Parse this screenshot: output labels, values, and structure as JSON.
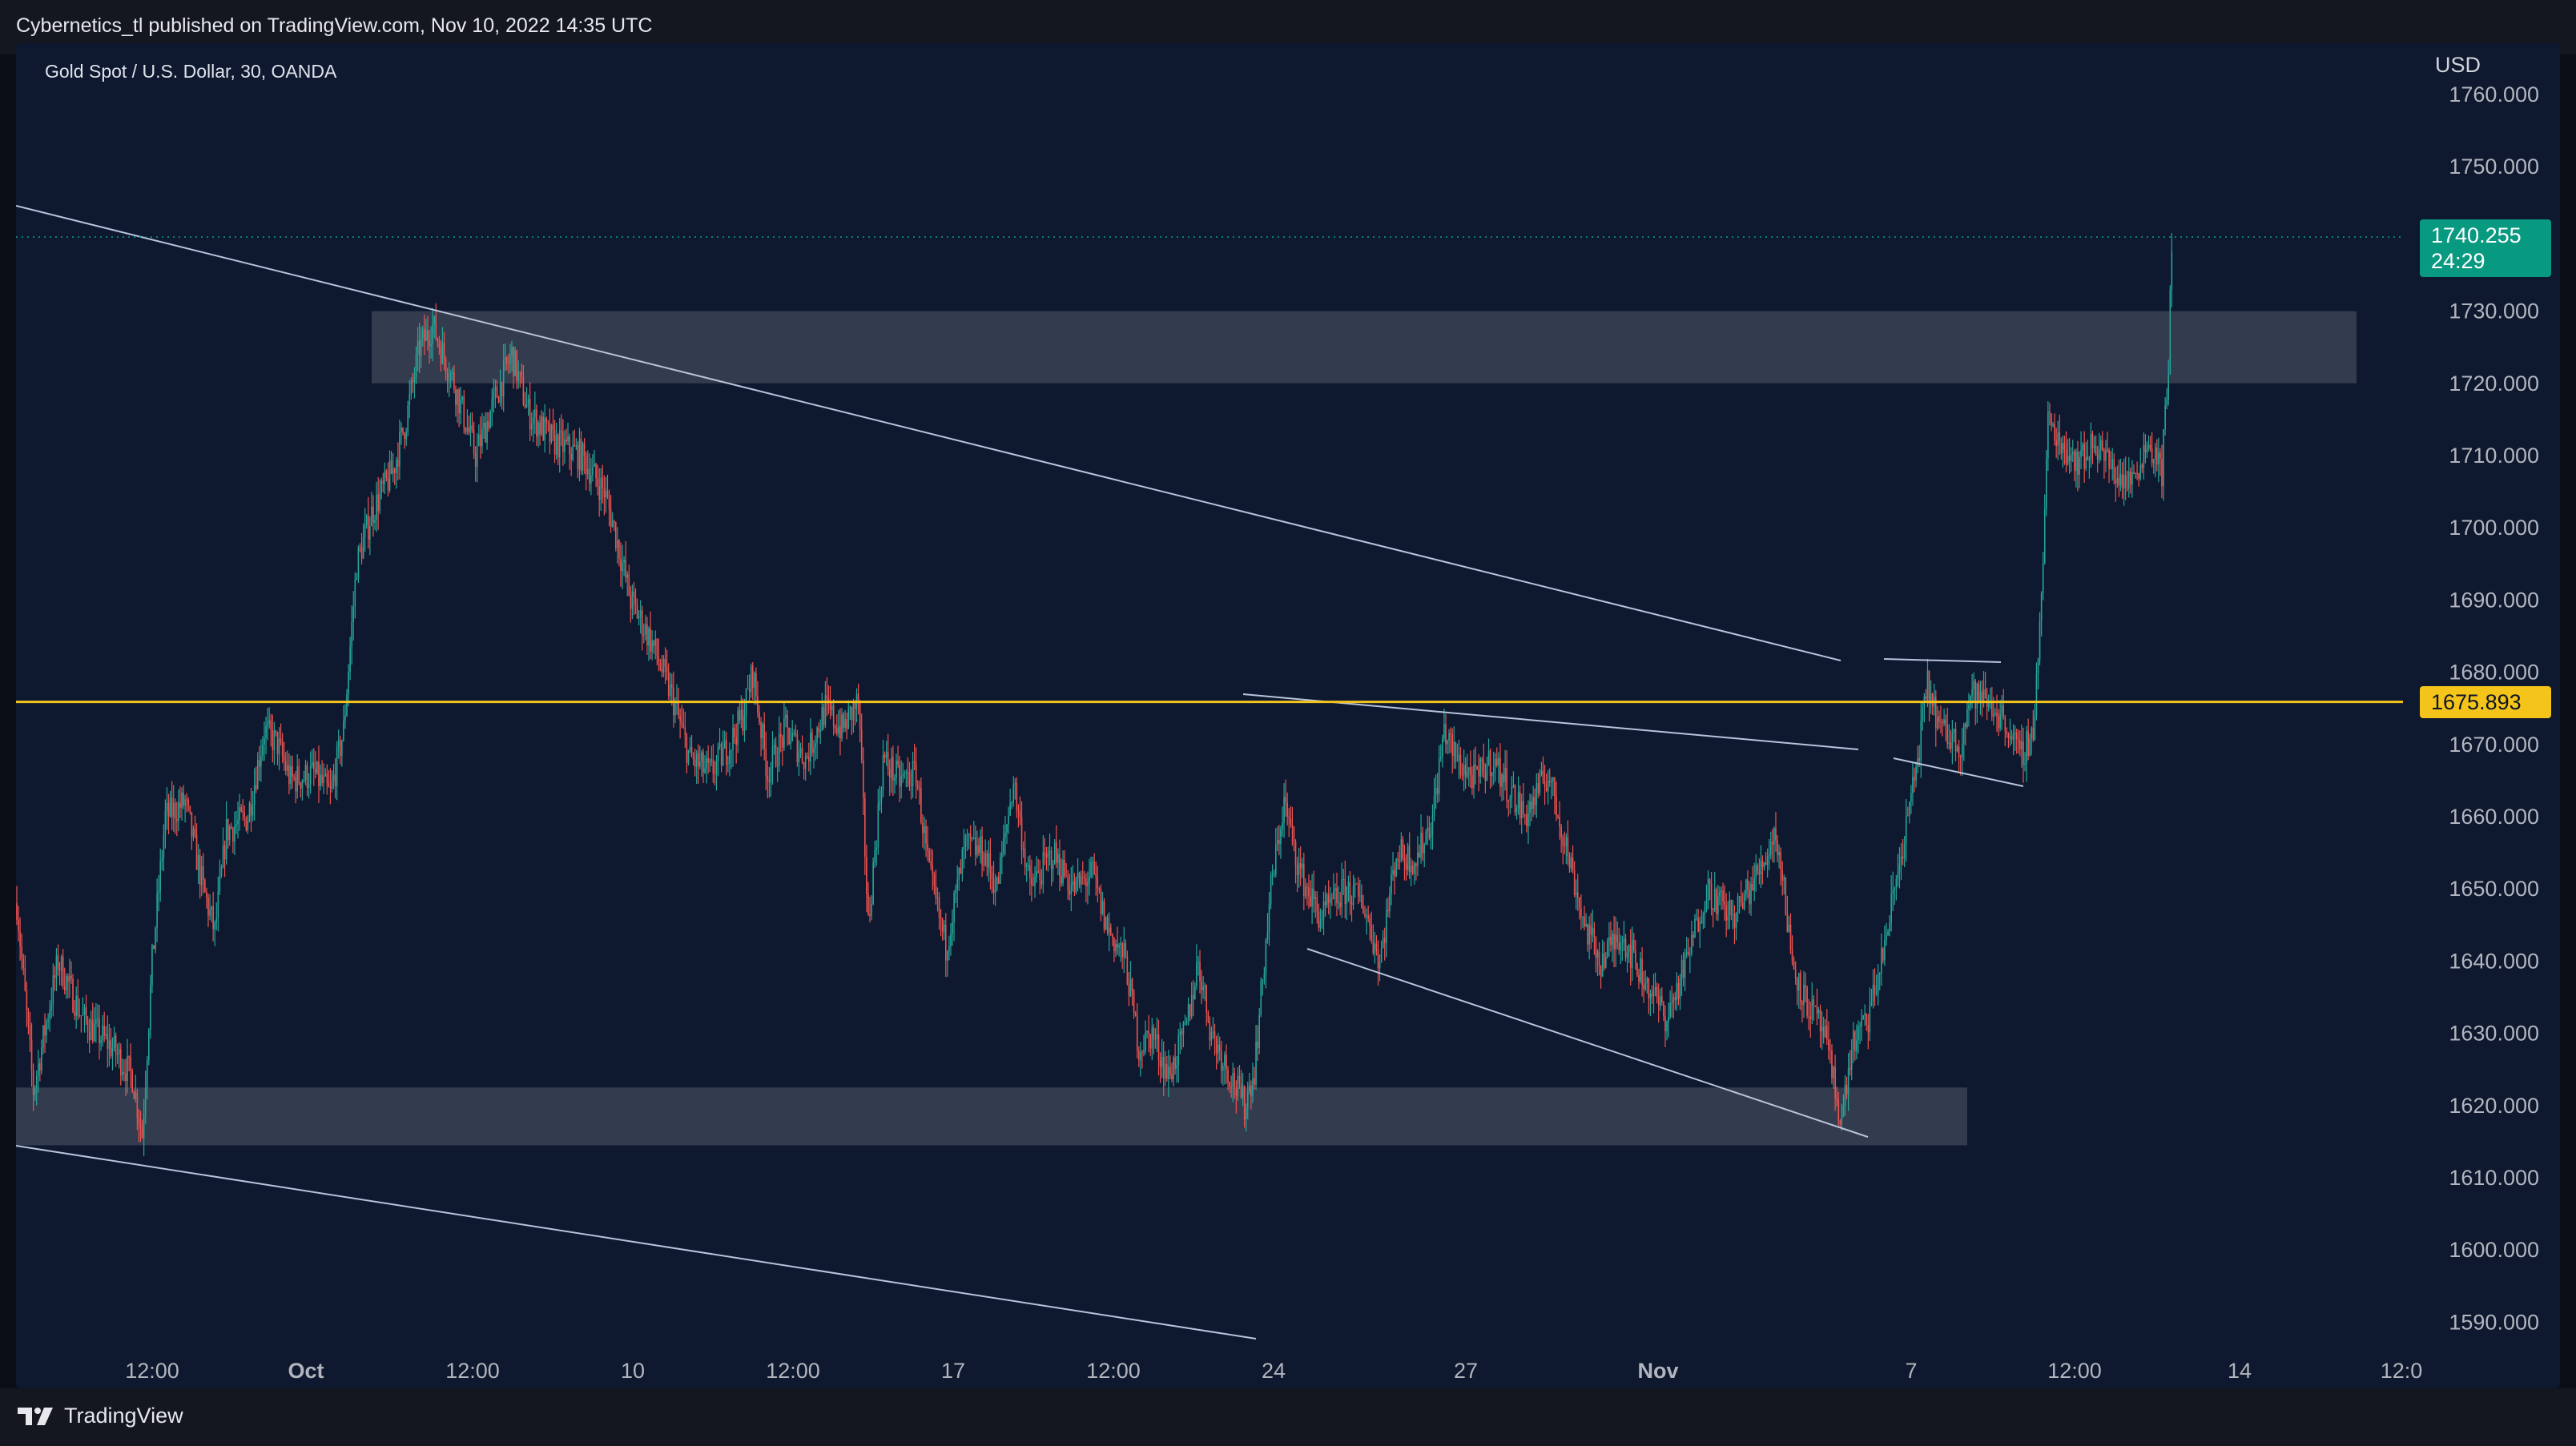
{
  "header": {
    "published_by": "Cybernetics_tl published on TradingView.com, Nov 10, 2022 14:35 UTC"
  },
  "footer": {
    "logo_text": "TradingView"
  },
  "chart_data": {
    "type": "candlestick",
    "symbol_label": "Gold Spot / U.S. Dollar, 30, OANDA",
    "currency": "USD",
    "timeframe_minutes": 30,
    "ylim": [
      1586,
      1762
    ],
    "y_ticks": [
      1590,
      1600,
      1610,
      1620,
      1630,
      1640,
      1650,
      1660,
      1670,
      1680,
      1690,
      1700,
      1710,
      1720,
      1730,
      1740,
      1750,
      1760
    ],
    "x_ticks": [
      "12:00",
      "Oct",
      "12:00",
      "10",
      "12:00",
      "17",
      "12:00",
      "24",
      "27",
      "Nov",
      "7",
      "12:00",
      "14",
      "12:0"
    ],
    "last_price": {
      "value": "1740.255",
      "countdown": "24:29",
      "numeric": 1740.255
    },
    "horizontal_level": {
      "value": "1675.893",
      "numeric": 1675.893,
      "color": "#f5c41a"
    },
    "supply_zone": {
      "from": 1720,
      "to": 1730
    },
    "demand_zone": {
      "from": 1614.5,
      "to": 1622.5
    },
    "colors": {
      "background": "#0e182e",
      "bull": "#26a69a",
      "bear": "#ef5350",
      "zone": "#3a4254",
      "trendline": "#b8c4dc",
      "last_price": "#089981",
      "level": "#f5c41a"
    },
    "price_path": [
      [
        0,
        1648
      ],
      [
        10,
        1622
      ],
      [
        25,
        1640
      ],
      [
        40,
        1632
      ],
      [
        58,
        1628
      ],
      [
        70,
        1624
      ],
      [
        76,
        1616
      ],
      [
        82,
        1640
      ],
      [
        90,
        1660
      ],
      [
        102,
        1662
      ],
      [
        113,
        1650
      ],
      [
        120,
        1644
      ],
      [
        127,
        1658
      ],
      [
        140,
        1660
      ],
      [
        150,
        1672
      ],
      [
        158,
        1670
      ],
      [
        166,
        1665
      ],
      [
        180,
        1666
      ],
      [
        190,
        1663
      ],
      [
        198,
        1672
      ],
      [
        206,
        1695
      ],
      [
        215,
        1702
      ],
      [
        228,
        1708
      ],
      [
        236,
        1715
      ],
      [
        244,
        1725
      ],
      [
        252,
        1728
      ],
      [
        265,
        1720
      ],
      [
        278,
        1710
      ],
      [
        290,
        1718
      ],
      [
        300,
        1724
      ],
      [
        310,
        1716
      ],
      [
        325,
        1712
      ],
      [
        342,
        1710
      ],
      [
        356,
        1705
      ],
      [
        362,
        1700
      ],
      [
        372,
        1690
      ],
      [
        385,
        1684
      ],
      [
        398,
        1676
      ],
      [
        408,
        1668
      ],
      [
        420,
        1666
      ],
      [
        432,
        1670
      ],
      [
        440,
        1674
      ],
      [
        446,
        1680
      ],
      [
        455,
        1666
      ],
      [
        466,
        1672
      ],
      [
        478,
        1668
      ],
      [
        490,
        1675
      ],
      [
        500,
        1672
      ],
      [
        510,
        1676
      ],
      [
        516,
        1645
      ],
      [
        525,
        1668
      ],
      [
        535,
        1665
      ],
      [
        545,
        1666
      ],
      [
        553,
        1652
      ],
      [
        563,
        1642
      ],
      [
        575,
        1656
      ],
      [
        586,
        1655
      ],
      [
        594,
        1650
      ],
      [
        604,
        1665
      ],
      [
        614,
        1650
      ],
      [
        628,
        1655
      ],
      [
        640,
        1650
      ],
      [
        652,
        1652
      ],
      [
        660,
        1645
      ],
      [
        672,
        1640
      ],
      [
        680,
        1628
      ],
      [
        688,
        1630
      ],
      [
        698,
        1624
      ],
      [
        708,
        1630
      ],
      [
        716,
        1640
      ],
      [
        724,
        1630
      ],
      [
        734,
        1625
      ],
      [
        744,
        1620
      ],
      [
        750,
        1625
      ],
      [
        760,
        1650
      ],
      [
        768,
        1662
      ],
      [
        778,
        1652
      ],
      [
        790,
        1646
      ],
      [
        806,
        1650
      ],
      [
        816,
        1648
      ],
      [
        826,
        1640
      ],
      [
        836,
        1655
      ],
      [
        848,
        1654
      ],
      [
        858,
        1660
      ],
      [
        865,
        1672
      ],
      [
        872,
        1668
      ],
      [
        884,
        1665
      ],
      [
        894,
        1668
      ],
      [
        904,
        1664
      ],
      [
        914,
        1660
      ],
      [
        928,
        1666
      ],
      [
        940,
        1655
      ],
      [
        950,
        1645
      ],
      [
        960,
        1640
      ],
      [
        972,
        1644
      ],
      [
        985,
        1638
      ],
      [
        1000,
        1632
      ],
      [
        1012,
        1640
      ],
      [
        1024,
        1650
      ],
      [
        1040,
        1646
      ],
      [
        1055,
        1652
      ],
      [
        1066,
        1658
      ],
      [
        1072,
        1648
      ],
      [
        1076,
        1640
      ],
      [
        1083,
        1635
      ],
      [
        1095,
        1630
      ],
      [
        1102,
        1622
      ],
      [
        1106,
        1618
      ],
      [
        1112,
        1628
      ],
      [
        1122,
        1632
      ],
      [
        1130,
        1640
      ],
      [
        1142,
        1655
      ],
      [
        1150,
        1665
      ],
      [
        1158,
        1678
      ],
      [
        1166,
        1672
      ],
      [
        1178,
        1670
      ],
      [
        1184,
        1677
      ],
      [
        1194,
        1676
      ],
      [
        1206,
        1673
      ],
      [
        1214,
        1668
      ],
      [
        1222,
        1672
      ],
      [
        1227,
        1690
      ],
      [
        1231,
        1715
      ],
      [
        1238,
        1712
      ],
      [
        1250,
        1709
      ],
      [
        1260,
        1712
      ],
      [
        1270,
        1708
      ],
      [
        1280,
        1706
      ],
      [
        1292,
        1712
      ],
      [
        1300,
        1708
      ],
      [
        1304,
        1722
      ],
      [
        1306,
        1740
      ]
    ]
  }
}
